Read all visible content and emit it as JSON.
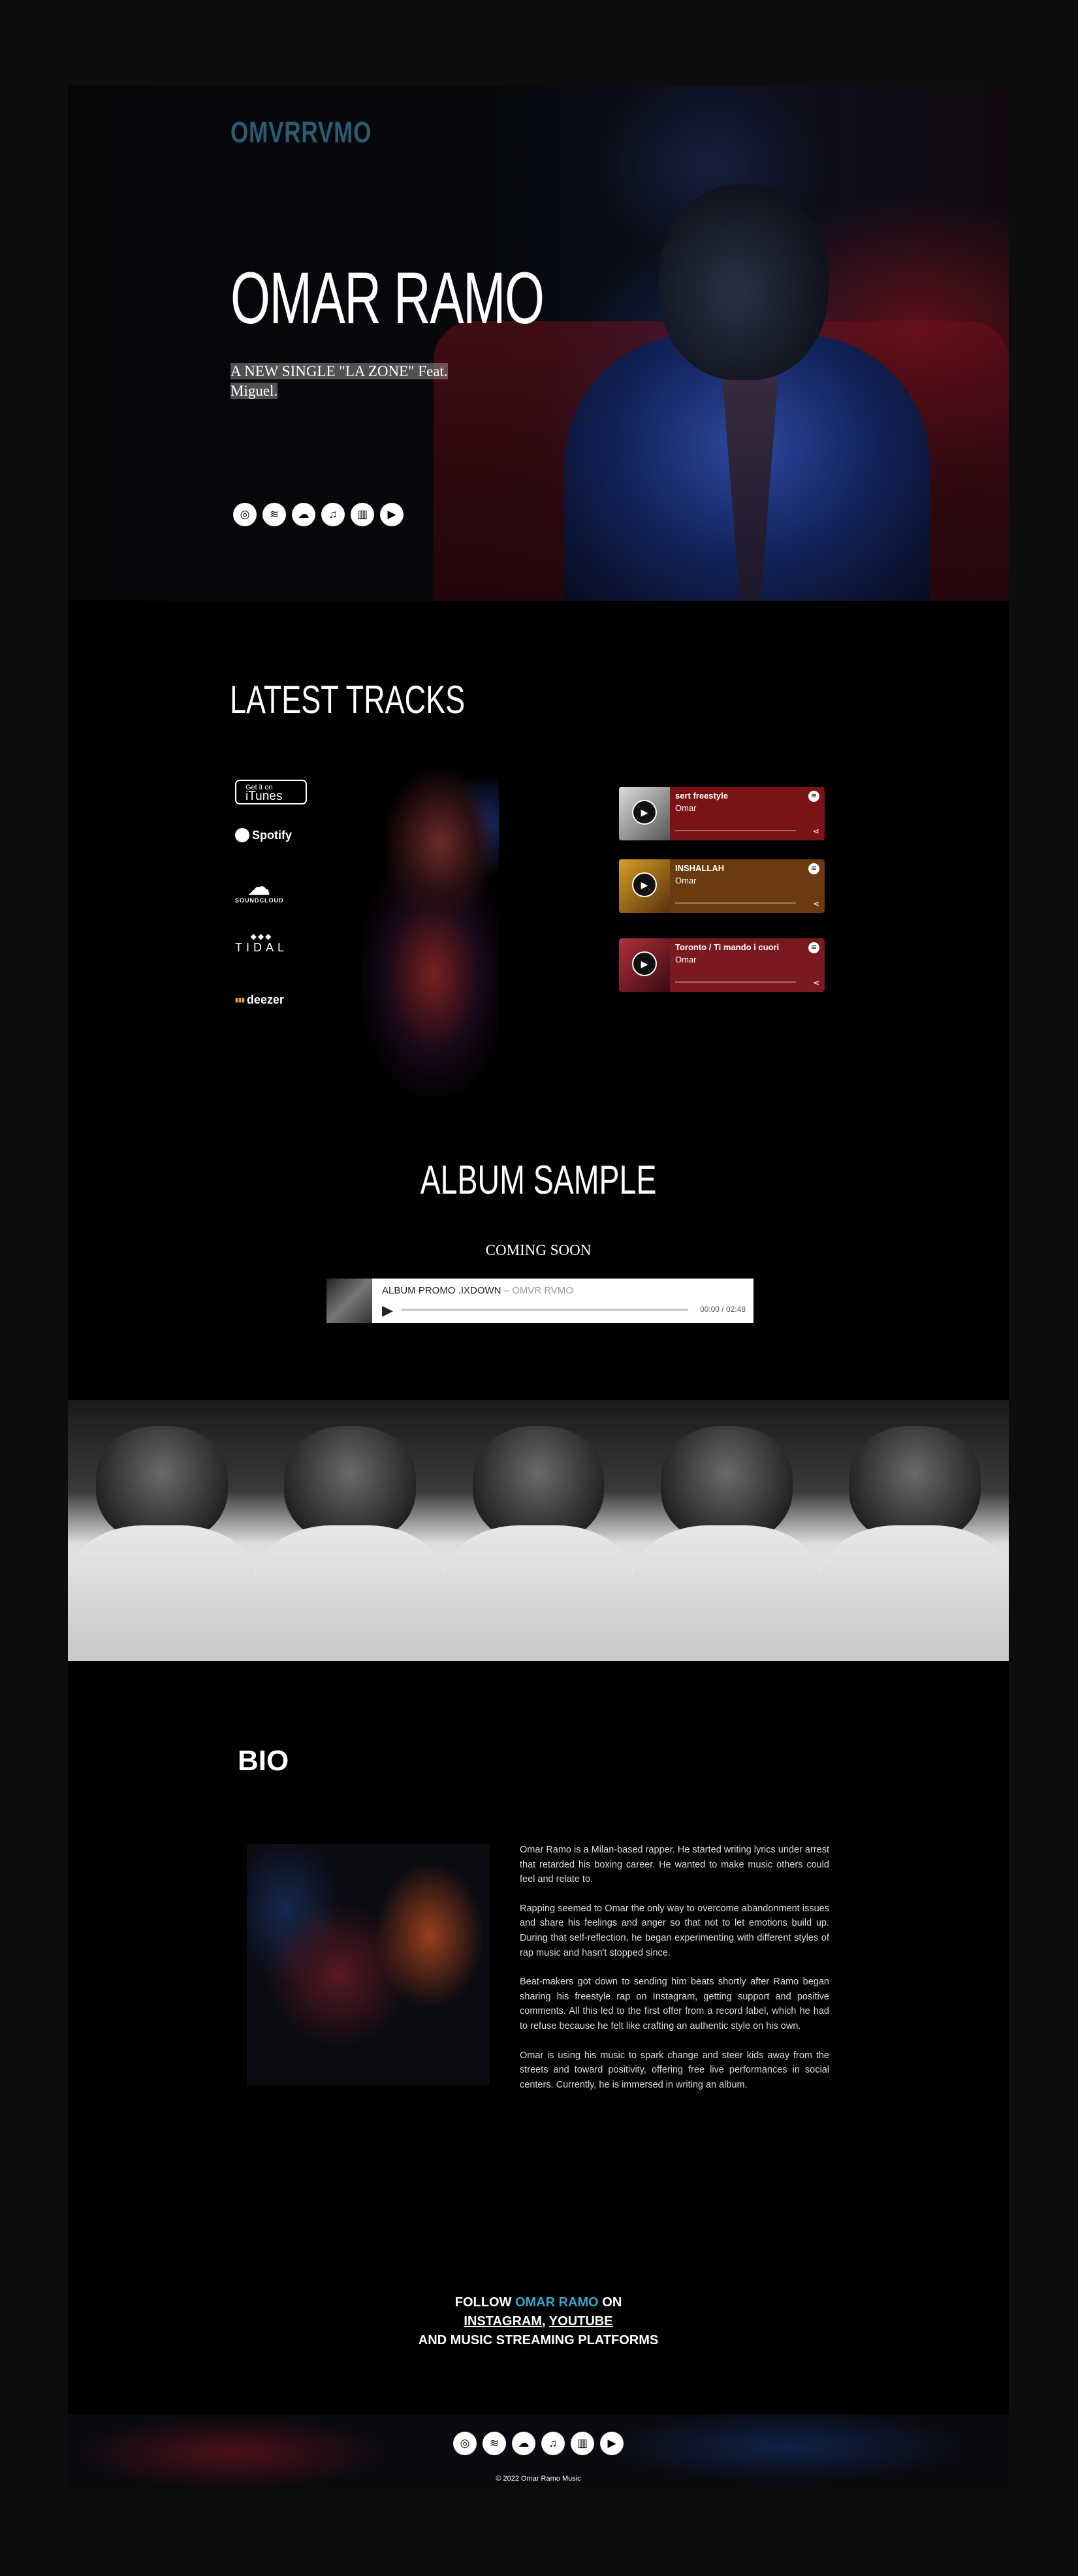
{
  "hero": {
    "logo": "OMVRRVMO",
    "title": "OMAR RAMO",
    "subtitle": "A NEW SINGLE  \"LA ZONE\" Feat. Miguel.",
    "icons": [
      "instagram-icon",
      "spotify-icon",
      "soundcloud-icon",
      "apple-music-icon",
      "deezer-icon",
      "youtube-icon"
    ]
  },
  "tracks": {
    "title": "LATEST TRACKS",
    "stores": {
      "itunes_small": "Get it on",
      "itunes": "iTunes",
      "spotify": "Spotify",
      "soundcloud": "SOUNDCLOUD",
      "tidal": "TIDAL",
      "deezer": "deezer"
    },
    "players": [
      {
        "title": "sert freestyle",
        "artist": "Omar",
        "color": "#7a1414"
      },
      {
        "title": "INSHALLAH",
        "artist": "Omar",
        "color": "#6a3a10"
      },
      {
        "title": "Toronto / Ti mando i cuori",
        "artist": "Omar",
        "color": "#7a1a20"
      }
    ]
  },
  "album": {
    "title": "ALBUM SAMPLE",
    "coming": "COMING SOON",
    "track": "ALBUM PROMO .IXDOWN",
    "artist": "OMVR RVMO",
    "time": "00:00 / 02:48"
  },
  "bio": {
    "title": "BIO",
    "p1": "Omar Ramo is a Milan-based rapper. He started writing lyrics under arrest that retarded his boxing career. He wanted to make music others could feel and relate to.",
    "p2": "Rapping seemed to Omar the only way to overcome abandonment issues and share his feelings and anger so that not to let emotions build up. During that self-reflection, he began experimenting with different styles of rap music and hasn't stopped since.",
    "p3": "Beat-makers got down to sending him beats shortly after Ramo began sharing his freestyle rap on Instagram, getting support and positive comments. All this led to the first offer from a record label, which he had to refuse because he felt like crafting an authentic style on his own.",
    "p4": "Omar is using his music to spark change and steer kids away from the streets and toward positivity, offering free live performances in social centers. Currently, he is immersed in writing an album."
  },
  "follow": {
    "prefix": "FOLLOW ",
    "name": "OMAR RAMO",
    "suffix": " ON",
    "instagram": "INSTAGRAM",
    "comma": ", ",
    "youtube": "YOUTUBE ",
    "line3": "AND MUSIC STREAMING PLATFORMS"
  },
  "footer": {
    "copyright": "© 2022 Omar Ramo Music"
  }
}
